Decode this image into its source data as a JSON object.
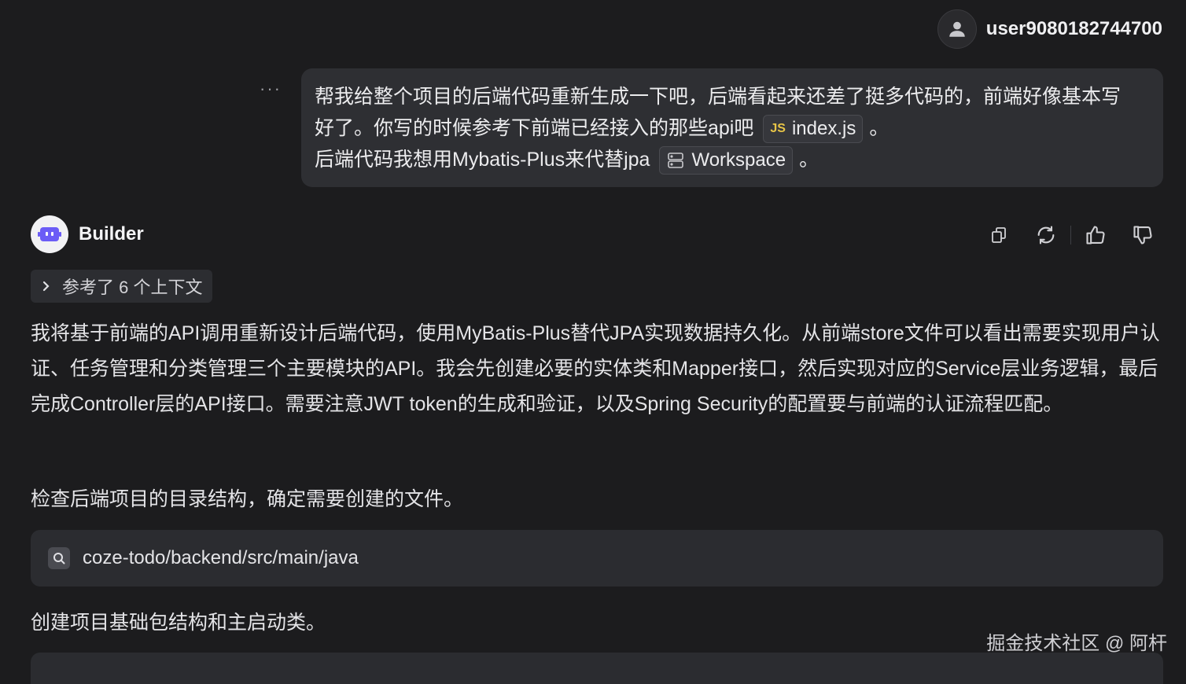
{
  "user": {
    "name": "user9080182744700",
    "avatar_icon": "user-icon"
  },
  "message_menu": "···",
  "user_message": {
    "part1": "帮我给整个项目的后端代码重新生成一下吧，后端看起来还差了挺多代码的，前端好像基本写好了。你写的时候参考下前端已经接入的那些api吧",
    "chip_file": {
      "tag": "JS",
      "label": "index.js"
    },
    "sep1": "。",
    "part2": "后端代码我想用Mybatis-Plus来代替jpa",
    "chip_workspace": {
      "icon": "server-icon",
      "label": "Workspace"
    },
    "sep2": "。"
  },
  "assistant": {
    "name": "Builder",
    "avatar_icon": "robot-icon",
    "actions": [
      "copy-icon",
      "regenerate-icon",
      "thumbs-up-icon",
      "thumbs-down-icon"
    ],
    "context_label": "参考了 6 个上下文",
    "paragraph1": "我将基于前端的API调用重新设计后端代码，使用MyBatis-Plus替代JPA实现数据持久化。从前端store文件可以看出需要实现用户认证、任务管理和分类管理三个主要模块的API。我会先创建必要的实体类和Mapper接口，然后实现对应的Service层业务逻辑，最后完成Controller层的API接口。需要注意JWT token的生成和验证，以及Spring Security的配置要与前端的认证流程匹配。",
    "paragraph2": "检查后端项目的目录结构，确定需要创建的文件。",
    "search_path": "coze-todo/backend/src/main/java",
    "paragraph3": "创建项目基础包结构和主启动类。"
  },
  "watermark": "掘金技术社区 @ 阿杆",
  "colors": {
    "background": "#1c1c1e",
    "bubble": "#2e2f33",
    "js_tag": "#e8c547"
  }
}
